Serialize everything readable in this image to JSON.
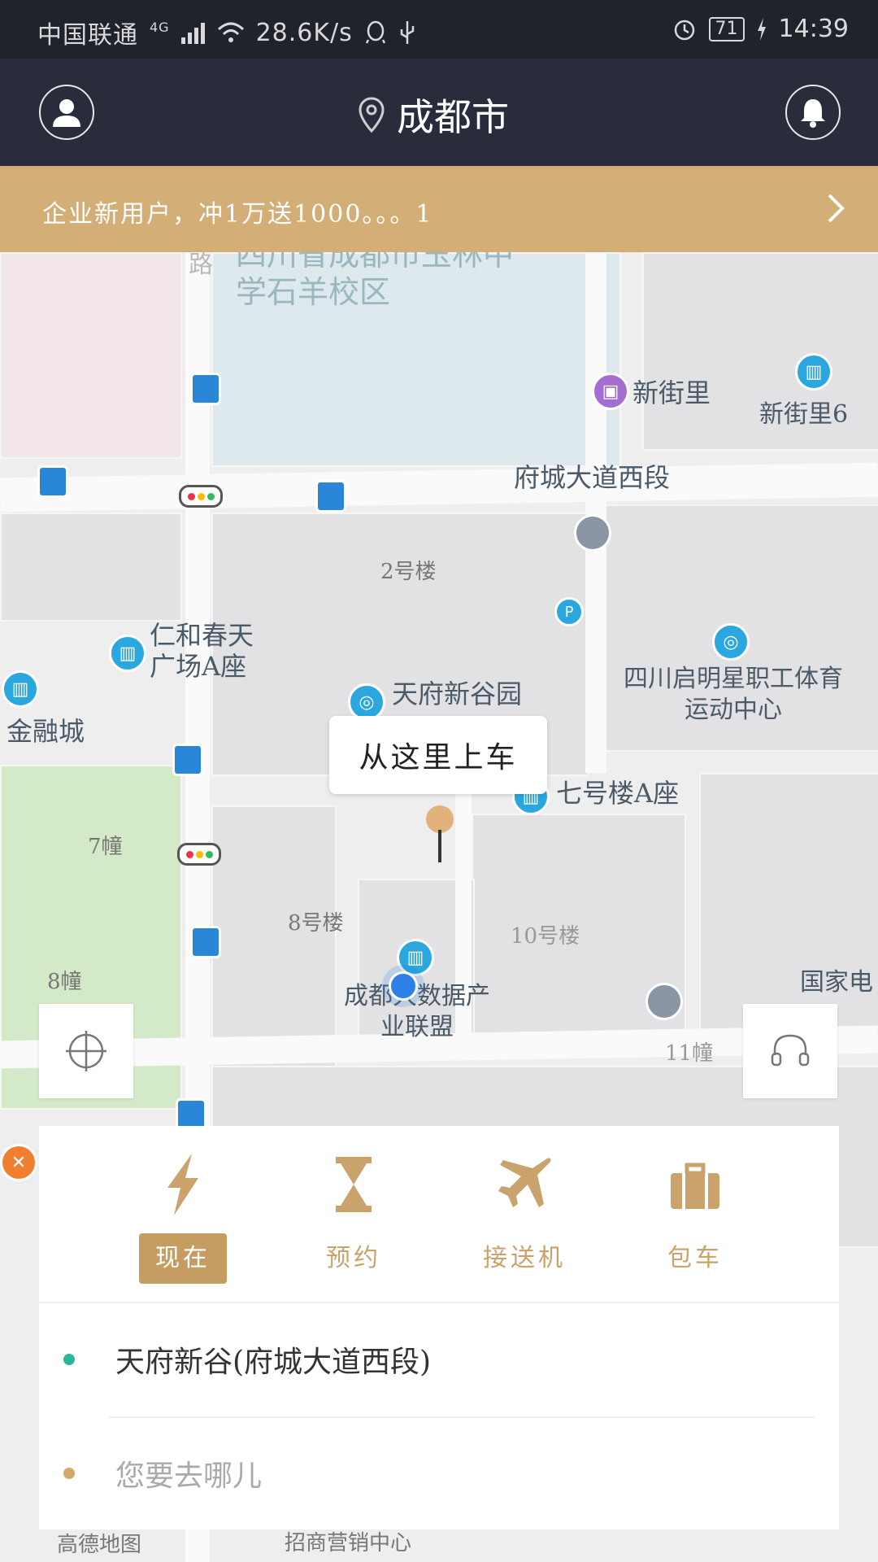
{
  "status_bar": {
    "carrier": "中国联通",
    "network": "4G",
    "speed": "28.6K/s",
    "battery": "71",
    "time": "14:39"
  },
  "header": {
    "city": "成都市",
    "profile_icon": "person-icon",
    "location_icon": "location-pin-icon",
    "notify_icon": "bell-icon"
  },
  "banner": {
    "text": "企业新用户，冲1万送1000。。。1",
    "chevron_icon": "chevron-right-icon"
  },
  "map": {
    "labels": {
      "school": "四川省成都市玉林中学石羊校区",
      "road_vertical": "成汉中路",
      "xinjieli": "新街里",
      "xinjieli6": "新街里6",
      "fucheng_road": "府城大道西段",
      "building2": "2号楼",
      "renhe": "仁和春天广场A座",
      "jinrongcheng": "金融城",
      "tianfu_park": "天府新谷园",
      "qiming": "四川启明星职工体育运动中心",
      "qihaolou": "七号楼A座",
      "qizhuang": "7幢",
      "bahaolou": "8号楼",
      "shihaolou": "10号楼",
      "bazhuang": "8幢",
      "bigdata": "成都大数据产业联盟",
      "shiyizhuang": "11幢",
      "guojia": "国家电"
    },
    "tooltip": "从这里上车",
    "map_brand": "高德地图",
    "bottom_poi": "招商营销中心"
  },
  "controls": {
    "locate_icon": "crosshair-icon",
    "service_icon": "headset-icon"
  },
  "modes": [
    {
      "label": "现在",
      "icon": "lightning-icon",
      "active": true
    },
    {
      "label": "预约",
      "icon": "hourglass-icon",
      "active": false
    },
    {
      "label": "接送机",
      "icon": "airplane-icon",
      "active": false
    },
    {
      "label": "包车",
      "icon": "briefcase-icon",
      "active": false
    }
  ],
  "trip": {
    "origin": "天府新谷(府城大道西段)",
    "destination_placeholder": "您要去哪儿"
  },
  "colors": {
    "header_bg": "#292c3a",
    "banner_bg": "#d3ae76",
    "accent_gold": "#c59d63",
    "origin_dot": "#2bb59a",
    "dest_dot": "#d4a868"
  }
}
